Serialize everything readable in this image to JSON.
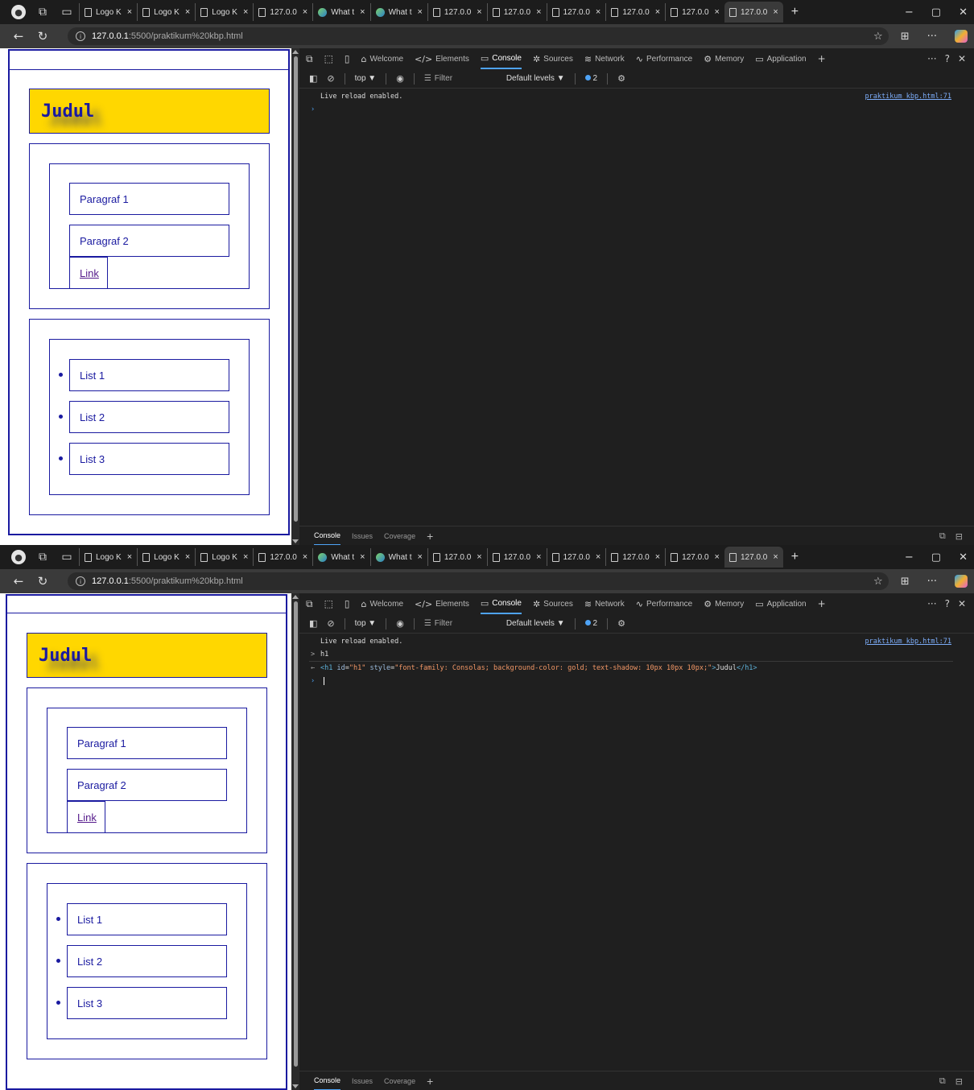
{
  "browser": {
    "tabs": [
      {
        "label": "Logo K",
        "icon": "page"
      },
      {
        "label": "Logo K",
        "icon": "page"
      },
      {
        "label": "Logo K",
        "icon": "page"
      },
      {
        "label": "127.0.0",
        "icon": "page"
      },
      {
        "label": "What t",
        "icon": "globe"
      },
      {
        "label": "What t",
        "icon": "globe"
      },
      {
        "label": "127.0.0",
        "icon": "page"
      },
      {
        "label": "127.0.0",
        "icon": "page"
      },
      {
        "label": "127.0.0",
        "icon": "page"
      },
      {
        "label": "127.0.0",
        "icon": "page"
      },
      {
        "label": "127.0.0",
        "icon": "page"
      },
      {
        "label": "127.0.0",
        "icon": "page",
        "active": true
      }
    ],
    "tab_close": "×",
    "new_tab": "+",
    "window": {
      "minimize": "−",
      "restore": "▢",
      "close": "✕"
    },
    "url": {
      "host": "127.0.0.1",
      "path": ":5500/praktikum%20kbp.html"
    },
    "icons": [
      "profile-icon",
      "workspaces-icon",
      "tab-actions-icon",
      "back-icon",
      "refresh-icon",
      "favorite-icon",
      "collections-icon",
      "more-icon",
      "copilot-icon"
    ]
  },
  "page": {
    "heading": "Judul",
    "paragraphs": [
      "Paragraf 1",
      "Paragraf 2"
    ],
    "link": "Link",
    "list": [
      "List 1",
      "List 2",
      "List 3"
    ]
  },
  "devtools": {
    "tabs": [
      {
        "label": "Welcome",
        "glyph": "⌂"
      },
      {
        "label": "Elements",
        "glyph": "</>"
      },
      {
        "label": "Console",
        "glyph": "▭",
        "active": true
      },
      {
        "label": "Sources",
        "glyph": "✲"
      },
      {
        "label": "Network",
        "glyph": "≋"
      },
      {
        "label": "Performance",
        "glyph": "∿"
      },
      {
        "label": "Memory",
        "glyph": "⚙"
      },
      {
        "label": "Application",
        "glyph": "▭"
      }
    ],
    "add_tab": "+",
    "right": {
      "more": "···",
      "help": "?",
      "close": "✕"
    },
    "toolbar": {
      "context": "top",
      "filter_placeholder": "Filter",
      "levels": "Default levels",
      "issues_count": "2"
    },
    "console_first": {
      "message": "Live reload enabled.",
      "source": "praktikum kbp.html:71"
    },
    "console_second": {
      "message": "Live reload enabled.",
      "source": "praktikum kbp.html:71",
      "input": "h1",
      "result_open_tag": "<h1",
      "result_id_attr": "id",
      "result_id_val": "\"h1\"",
      "result_style_attr": "style",
      "result_style_val": "\"font-family: Consolas; background-color: gold; text-shadow: 10px 10px 10px;\"",
      "result_text": "Judul",
      "result_close_tag": "</h1>"
    },
    "drawer": {
      "tabs": [
        "Console",
        "Issues",
        "Coverage"
      ],
      "add": "+"
    }
  },
  "colors": {
    "accent": "#1a1aa0",
    "heading_bg": "#ffd700",
    "devtools_bg": "#1f1f1f",
    "link": "#551a8b"
  }
}
